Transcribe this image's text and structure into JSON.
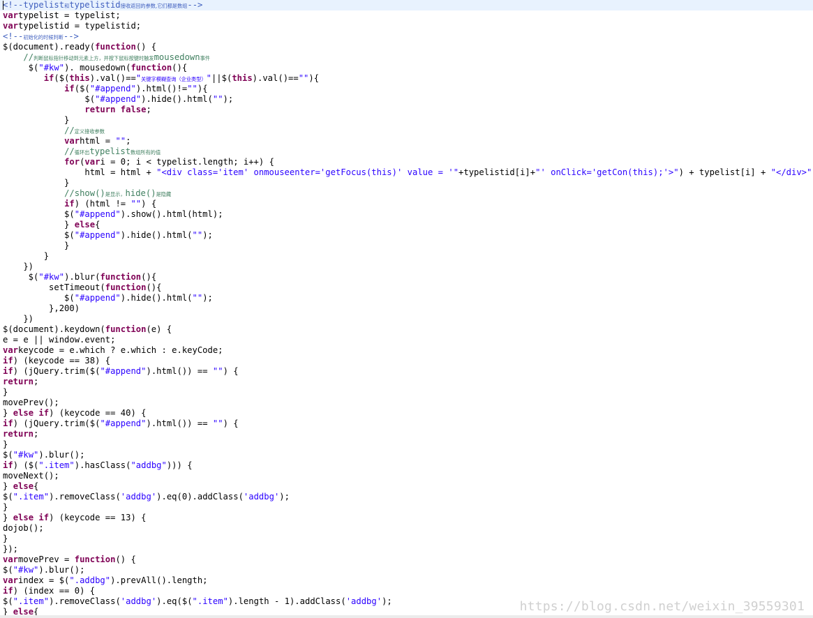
{
  "editor": {
    "lines": [
      [
        [
          "hc",
          "<!--"
        ],
        [
          "hc",
          "typelist"
        ],
        [
          "hc cjk",
          "和"
        ],
        [
          "hc",
          "typelistid"
        ],
        [
          "hc cjk",
          "接收返回的参数,它们都是数组"
        ],
        [
          "hc",
          "-->"
        ]
      ],
      [
        [
          "kw",
          "var"
        ],
        [
          "",
          "typelist = typelist;"
        ]
      ],
      [
        [
          "kw",
          "var"
        ],
        [
          "",
          "typelistid = typelistid;"
        ]
      ],
      [
        [
          "hc",
          "<!--"
        ],
        [
          "hc cjk",
          "初始化的时候判断"
        ],
        [
          "hc",
          "-->"
        ]
      ],
      [
        [
          "",
          "$(document).ready("
        ],
        [
          "kw",
          "function"
        ],
        [
          "",
          "() {"
        ]
      ],
      [
        [
          "",
          "    "
        ],
        [
          "cm",
          "//"
        ],
        [
          "cm cjk",
          "判断鼠标指针移动到元素上方，并按下鼠标按键时触发"
        ],
        [
          "cm",
          "mousedown"
        ],
        [
          "cm cjk",
          "事件"
        ]
      ],
      [
        [
          "",
          "     $("
        ],
        [
          "str",
          "\"#kw\""
        ],
        [
          "",
          "). mousedown("
        ],
        [
          "kw",
          "function"
        ],
        [
          "",
          "(){"
        ]
      ],
      [
        [
          "",
          "        "
        ],
        [
          "kw",
          "if"
        ],
        [
          "",
          "($("
        ],
        [
          "kw",
          "this"
        ],
        [
          "",
          ").val()=="
        ],
        [
          "str",
          "\""
        ],
        [
          "str cjk",
          "关键字模糊查询（企业类型）"
        ],
        [
          "str",
          "\""
        ],
        [
          "",
          "||$("
        ],
        [
          "kw",
          "this"
        ],
        [
          "",
          ").val()=="
        ],
        [
          "str",
          "\"\""
        ],
        [
          "",
          ")"
        ],
        [
          "",
          "{"
        ]
      ],
      [
        [
          "",
          "            "
        ],
        [
          "kw",
          "if"
        ],
        [
          "",
          "($("
        ],
        [
          "str",
          "\"#append\""
        ],
        [
          "",
          ").html()!="
        ],
        [
          "str",
          "\"\""
        ],
        [
          "",
          ")"
        ],
        [
          "",
          "{"
        ]
      ],
      [
        [
          "",
          "                $("
        ],
        [
          "str",
          "\"#append\""
        ],
        [
          "",
          ").hide().html("
        ],
        [
          "str",
          "\"\""
        ],
        [
          "",
          ");"
        ]
      ],
      [
        [
          "",
          "                "
        ],
        [
          "kw",
          "return false"
        ],
        [
          "",
          ";"
        ]
      ],
      [
        [
          "",
          "            }"
        ]
      ],
      [
        [
          "",
          "            "
        ],
        [
          "cm",
          "//"
        ],
        [
          "cm cjk",
          "定义接收参数"
        ]
      ],
      [
        [
          "",
          "            "
        ],
        [
          "kw",
          "var"
        ],
        [
          "",
          "html = "
        ],
        [
          "str",
          "\"\""
        ],
        [
          "",
          ";"
        ]
      ],
      [
        [
          "",
          "            "
        ],
        [
          "cm",
          "//"
        ],
        [
          "cm cjk",
          "循环出"
        ],
        [
          "cm",
          "typelist"
        ],
        [
          "cm cjk",
          "数组所有的值"
        ]
      ],
      [
        [
          "",
          "            "
        ],
        [
          "kw",
          "for"
        ],
        [
          "",
          "("
        ],
        [
          "kw",
          "var"
        ],
        [
          "",
          "i = 0; i < typelist.length; i++) {"
        ]
      ],
      [
        [
          "",
          "                html = html + "
        ],
        [
          "str",
          "\"<div class='item' onmouseenter='getFocus(this)' value = '\""
        ],
        [
          "",
          "+typelistid[i]+"
        ],
        [
          "str",
          "\"' onClick='getCon(this);'>\""
        ],
        [
          "",
          ") + typelist[i] + "
        ],
        [
          "str",
          "\"</div>\""
        ]
      ],
      [
        [
          "",
          "            }"
        ]
      ],
      [
        [
          "",
          "            "
        ],
        [
          "cm",
          "//show()"
        ],
        [
          "cm cjk",
          "是显示，"
        ],
        [
          "cm",
          "hide()"
        ],
        [
          "cm cjk",
          "是隐藏"
        ]
      ],
      [
        [
          "",
          "            "
        ],
        [
          "kw",
          "if"
        ],
        [
          "",
          ") (html != "
        ],
        [
          "str",
          "\"\""
        ],
        [
          "",
          ") {"
        ]
      ],
      [
        [
          "",
          "            $("
        ],
        [
          "str",
          "\"#append\""
        ],
        [
          "",
          ").show().html(html);"
        ]
      ],
      [
        [
          "",
          "            } "
        ],
        [
          "kw",
          "else"
        ],
        [
          "",
          "{"
        ]
      ],
      [
        [
          "",
          "            $("
        ],
        [
          "str",
          "\"#append\""
        ],
        [
          "",
          ").hide().html("
        ],
        [
          "str",
          "\"\""
        ],
        [
          "",
          ");"
        ]
      ],
      [
        [
          "",
          "            }"
        ]
      ],
      [
        [
          "",
          "        }"
        ]
      ],
      [
        [
          "",
          "    })"
        ]
      ],
      [
        [
          "",
          "     $("
        ],
        [
          "str",
          "\"#kw\""
        ],
        [
          "",
          ").blur("
        ],
        [
          "kw",
          "function"
        ],
        [
          "",
          "(){"
        ]
      ],
      [
        [
          "",
          "         setTimeout("
        ],
        [
          "kw",
          "function"
        ],
        [
          "",
          "(){"
        ]
      ],
      [
        [
          "",
          "            $("
        ],
        [
          "str",
          "\"#append\""
        ],
        [
          "",
          ").hide().html("
        ],
        [
          "str",
          "\"\""
        ],
        [
          "",
          ");"
        ]
      ],
      [
        [
          "",
          "         },200)"
        ]
      ],
      [
        [
          "",
          "    })"
        ]
      ],
      [
        [
          "",
          "$(document).keydown("
        ],
        [
          "kw",
          "function"
        ],
        [
          "",
          "(e) {"
        ]
      ],
      [
        [
          "",
          "e = e || window.event;"
        ]
      ],
      [
        [
          "kw",
          "var"
        ],
        [
          "",
          "keycode = e.which ? e.which : e.keyCode;"
        ]
      ],
      [
        [
          "kw",
          "if"
        ],
        [
          "",
          ") (keycode == 38) {"
        ]
      ],
      [
        [
          "kw",
          "if"
        ],
        [
          "",
          ") (jQuery.trim($("
        ],
        [
          "str",
          "\"#append\""
        ],
        [
          "",
          ").html()) == "
        ],
        [
          "str",
          "\"\""
        ],
        [
          "",
          ") {"
        ]
      ],
      [
        [
          "kw",
          "return"
        ],
        [
          "",
          ";"
        ]
      ],
      [
        [
          "",
          "}"
        ]
      ],
      [
        [
          "",
          "movePrev();"
        ]
      ],
      [
        [
          "",
          "} "
        ],
        [
          "kw",
          "else if"
        ],
        [
          "",
          ") (keycode == 40) {"
        ]
      ],
      [
        [
          "kw",
          "if"
        ],
        [
          "",
          ") (jQuery.trim($("
        ],
        [
          "str",
          "\"#append\""
        ],
        [
          "",
          ").html()) == "
        ],
        [
          "str",
          "\"\""
        ],
        [
          "",
          ") {"
        ]
      ],
      [
        [
          "kw",
          "return"
        ],
        [
          "",
          ";"
        ]
      ],
      [
        [
          "",
          "}"
        ]
      ],
      [
        [
          "",
          "$("
        ],
        [
          "str",
          "\"#kw\""
        ],
        [
          "",
          ").blur();"
        ]
      ],
      [
        [
          "kw",
          "if"
        ],
        [
          "",
          ") ($("
        ],
        [
          "str",
          "\".item\""
        ],
        [
          "",
          ").hasClass("
        ],
        [
          "str",
          "\"addbg\""
        ],
        [
          "",
          "))) {"
        ]
      ],
      [
        [
          "",
          "moveNext();"
        ]
      ],
      [
        [
          "",
          "} "
        ],
        [
          "kw",
          "else"
        ],
        [
          "",
          "{"
        ]
      ],
      [
        [
          "",
          "$("
        ],
        [
          "str",
          "\".item\""
        ],
        [
          "",
          ").removeClass("
        ],
        [
          "str",
          "'addbg'"
        ],
        [
          "",
          ").eq(0).addClass("
        ],
        [
          "str",
          "'addbg'"
        ],
        [
          "",
          ");"
        ]
      ],
      [
        [
          "",
          "}"
        ]
      ],
      [
        [
          "",
          "} "
        ],
        [
          "kw",
          "else if"
        ],
        [
          "",
          ") (keycode == 13) {"
        ]
      ],
      [
        [
          "",
          "dojob();"
        ]
      ],
      [
        [
          "",
          "}"
        ]
      ],
      [
        [
          "",
          "});"
        ]
      ],
      [
        [
          "kw",
          "var"
        ],
        [
          "",
          "movePrev = "
        ],
        [
          "kw",
          "function"
        ],
        [
          "",
          "() {"
        ]
      ],
      [
        [
          "",
          "$("
        ],
        [
          "str",
          "\"#kw\""
        ],
        [
          "",
          ").blur();"
        ]
      ],
      [
        [
          "kw",
          "var"
        ],
        [
          "",
          "index = $("
        ],
        [
          "str",
          "\".addbg\""
        ],
        [
          "",
          ").prevAll().length;"
        ]
      ],
      [
        [
          "kw",
          "if"
        ],
        [
          "",
          ") (index == 0) {"
        ]
      ],
      [
        [
          "",
          "$("
        ],
        [
          "str",
          "\".item\""
        ],
        [
          "",
          ").removeClass("
        ],
        [
          "str",
          "'addbg'"
        ],
        [
          "",
          ").eq($("
        ],
        [
          "str",
          "\".item\""
        ],
        [
          "",
          ").length - 1).addClass("
        ],
        [
          "str",
          "'addbg'"
        ],
        [
          "",
          ");"
        ]
      ],
      [
        [
          "",
          "} "
        ],
        [
          "kw",
          "else"
        ],
        [
          "",
          "{"
        ]
      ]
    ]
  },
  "watermark": "https://blog.csdn.net/weixin_39559301"
}
